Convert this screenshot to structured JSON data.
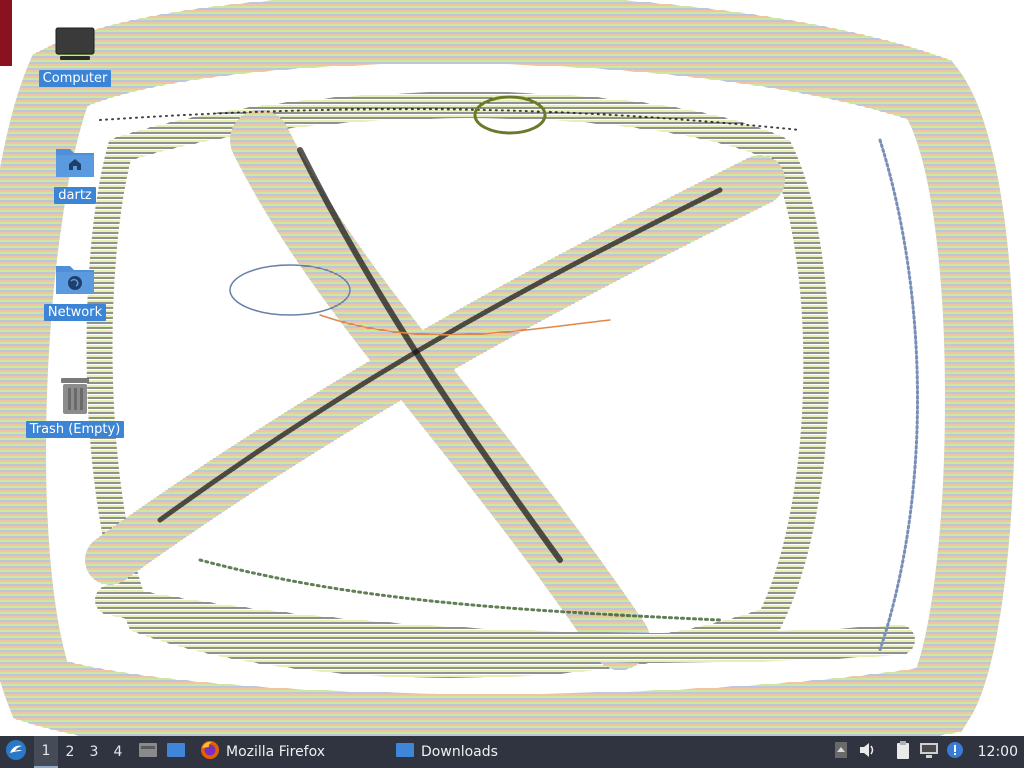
{
  "desktop": {
    "icons": [
      {
        "label": "Computer",
        "icon": "computer-icon"
      },
      {
        "label": "dartz",
        "icon": "home-folder-icon"
      },
      {
        "label": "Network",
        "icon": "network-folder-icon"
      },
      {
        "label": "Trash (Empty)",
        "icon": "trash-icon"
      }
    ]
  },
  "taskbar": {
    "workspaces": [
      "1",
      "2",
      "3",
      "4"
    ],
    "active_workspace": "1",
    "tasks": [
      {
        "label": "Mozilla Firefox",
        "icon": "firefox-icon"
      },
      {
        "label": "Downloads",
        "icon": "folder-icon"
      }
    ],
    "clock": "12:00"
  },
  "colors": {
    "panel": "#2f3440",
    "icon_label_bg": "#3b84d6",
    "folder_blue": "#4f8fd8",
    "accent_red": "#8a1220"
  }
}
